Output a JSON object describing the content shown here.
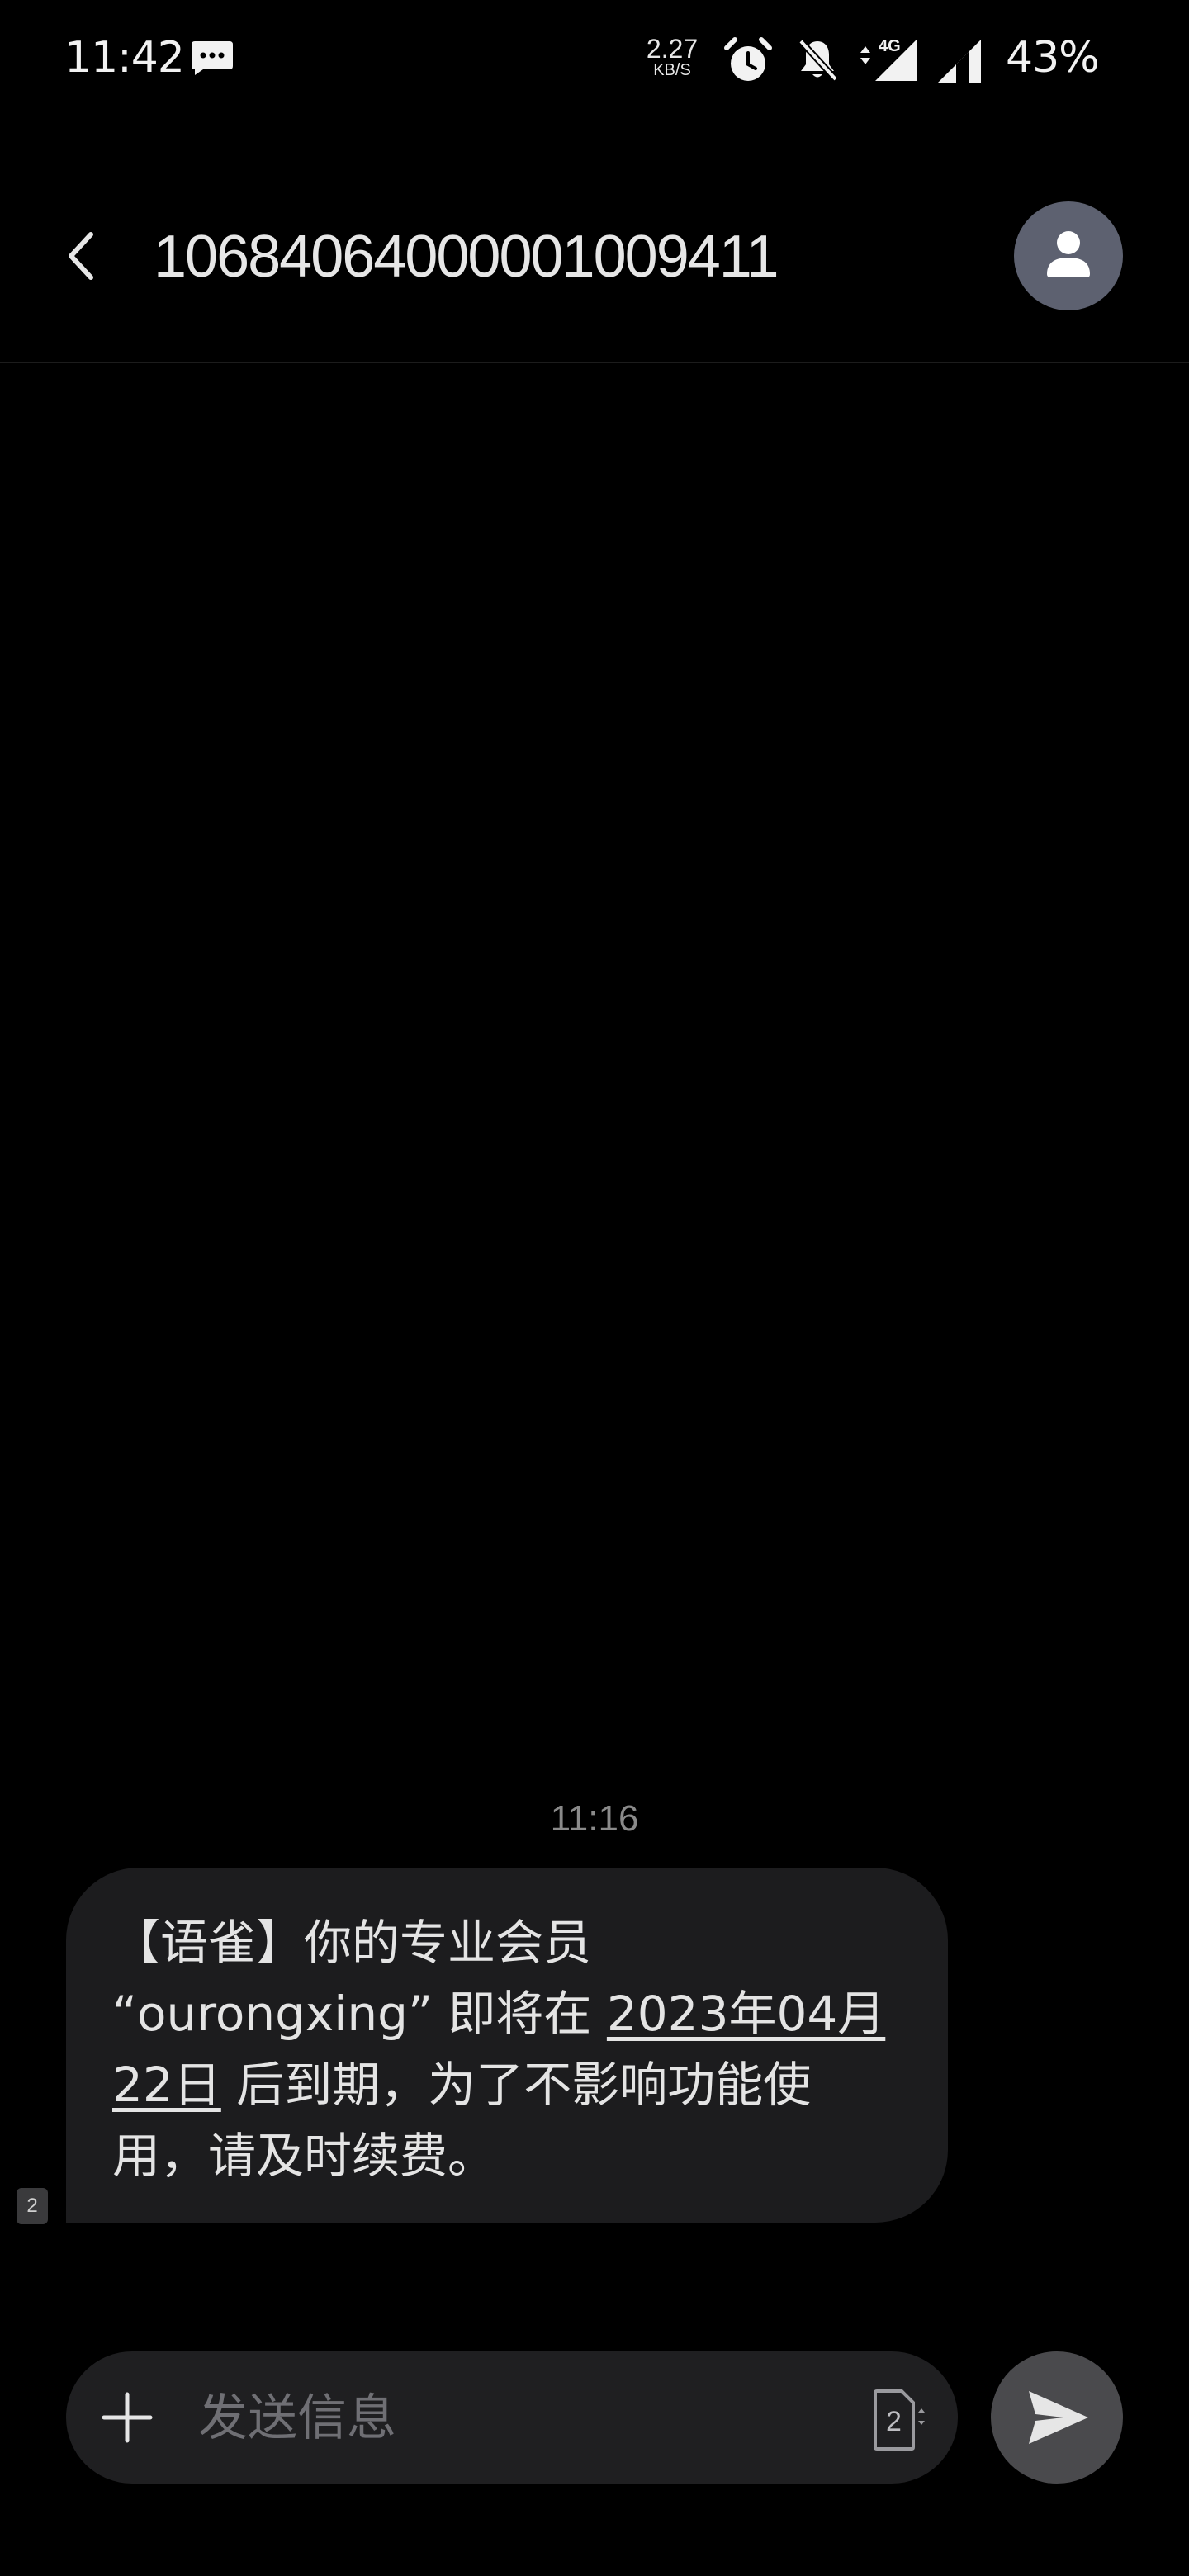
{
  "status_bar": {
    "time": "11:42",
    "net_speed_value": "2.27",
    "net_speed_unit": "KB/S",
    "network_type": "4G",
    "battery": "43%",
    "icons": [
      "message-notification-icon",
      "alarm-icon",
      "mute-icon",
      "data-arrows-icon",
      "signal-icon",
      "signal-icon"
    ]
  },
  "header": {
    "title": "1068406400000 1009411",
    "title_display": "10684064000001009411",
    "avatar_icon": "person-icon"
  },
  "conversation": {
    "messages": [
      {
        "timestamp": "11:16",
        "text_part1": "【语雀】你的专业会员",
        "text_part2": "“ourongxing” 即将在 ",
        "date_link_part1": "2023年04月",
        "date_link_part2": "22日",
        "text_part3": " 后到期，为了不影响功能使",
        "text_part4": "用，请及时续费。",
        "sim_slot": "2"
      }
    ]
  },
  "compose": {
    "placeholder": "发送信息",
    "sim_slot": "2"
  },
  "colors": {
    "background": "#000000",
    "bubble": "#1c1c1e",
    "compose": "#1f1f21",
    "avatar": "#5d6170",
    "send_button": "#4a4a4d"
  }
}
